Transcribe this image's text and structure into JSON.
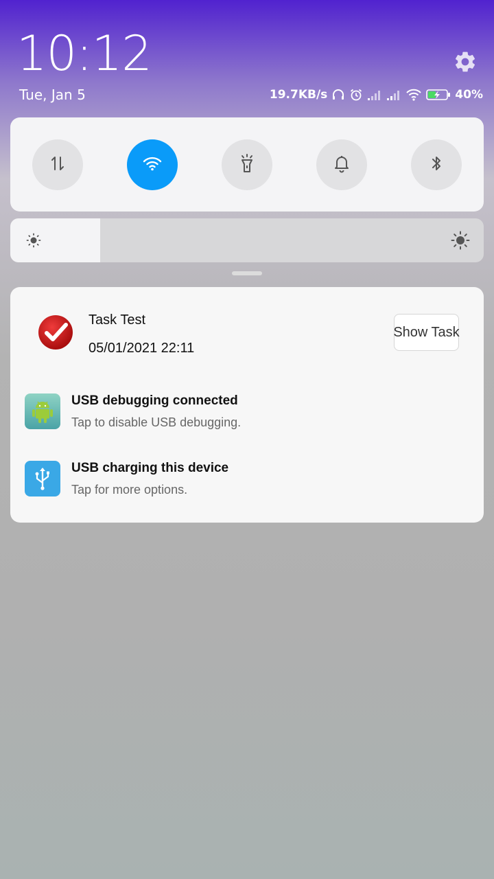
{
  "status_bar": {
    "time": "10:12",
    "date": "Tue, Jan 5",
    "network_speed": "19.7KB/s",
    "battery_percent": "40%",
    "icons": [
      "headset-icon",
      "alarm-icon",
      "signal-icon",
      "signal-icon",
      "wifi-icon",
      "battery-charging-icon"
    ]
  },
  "quick_toggles": [
    {
      "name": "mobile-data",
      "icon": "data-arrows-icon",
      "active": false
    },
    {
      "name": "wifi",
      "icon": "wifi-icon",
      "active": true
    },
    {
      "name": "flashlight",
      "icon": "flashlight-icon",
      "active": false
    },
    {
      "name": "sound",
      "icon": "bell-icon",
      "active": false
    },
    {
      "name": "bluetooth",
      "icon": "bluetooth-icon",
      "active": false
    }
  ],
  "brightness": {
    "level": 0.19
  },
  "notifications": {
    "task": {
      "title": "Task Test",
      "time": "05/01/2021 22:11",
      "action_label": "Show Task"
    },
    "usb_debugging": {
      "title": "USB debugging connected",
      "subtitle": "Tap to disable USB debugging."
    },
    "usb_charging": {
      "title": "USB charging this device",
      "subtitle": "Tap for more options."
    }
  },
  "colors": {
    "accent": "#0a9bf9",
    "header_gradient_top": "#5122cf"
  }
}
